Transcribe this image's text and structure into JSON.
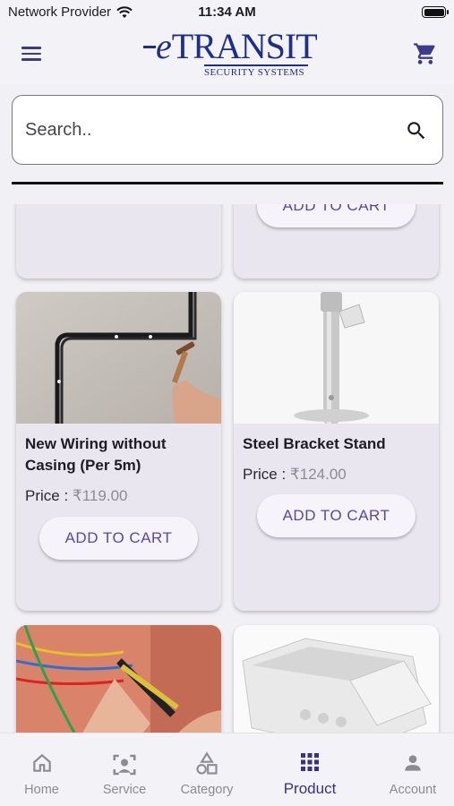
{
  "status_bar": {
    "carrier": "Network Provider",
    "time": "11:34 AM"
  },
  "app_bar": {
    "logo_e": "e",
    "logo_name": "TRANSIT",
    "logo_subtitle": "SECURITY SYSTEMS",
    "menu_icon": "hamburger-menu-icon",
    "cart_icon": "shopping-cart-icon"
  },
  "search": {
    "placeholder": "Search..",
    "icon": "search-icon"
  },
  "products": {
    "partial_top": [
      {
        "button_label": ""
      },
      {
        "button_label": "ADD TO CART"
      }
    ],
    "items": [
      {
        "name": "New Wiring without Casing (Per 5m)",
        "price_label": "Price :",
        "price": "₹119.00",
        "button_label": "ADD TO CART"
      },
      {
        "name": "Steel Bracket Stand",
        "price_label": "Price :",
        "price": "₹124.00",
        "button_label": "ADD TO CART"
      }
    ]
  },
  "bottom_nav": {
    "items": [
      {
        "label": "Home",
        "icon": "home-icon"
      },
      {
        "label": "Service",
        "icon": "service-person-icon"
      },
      {
        "label": "Category",
        "icon": "category-shapes-icon"
      },
      {
        "label": "Product",
        "icon": "grid-icon",
        "active": true
      },
      {
        "label": "Account",
        "icon": "account-icon"
      }
    ]
  },
  "colors": {
    "accent": "#3c3a8c",
    "button_text": "#5a48a8",
    "card_bg": "#e9e6ef",
    "brand": "#1e2f8a"
  }
}
